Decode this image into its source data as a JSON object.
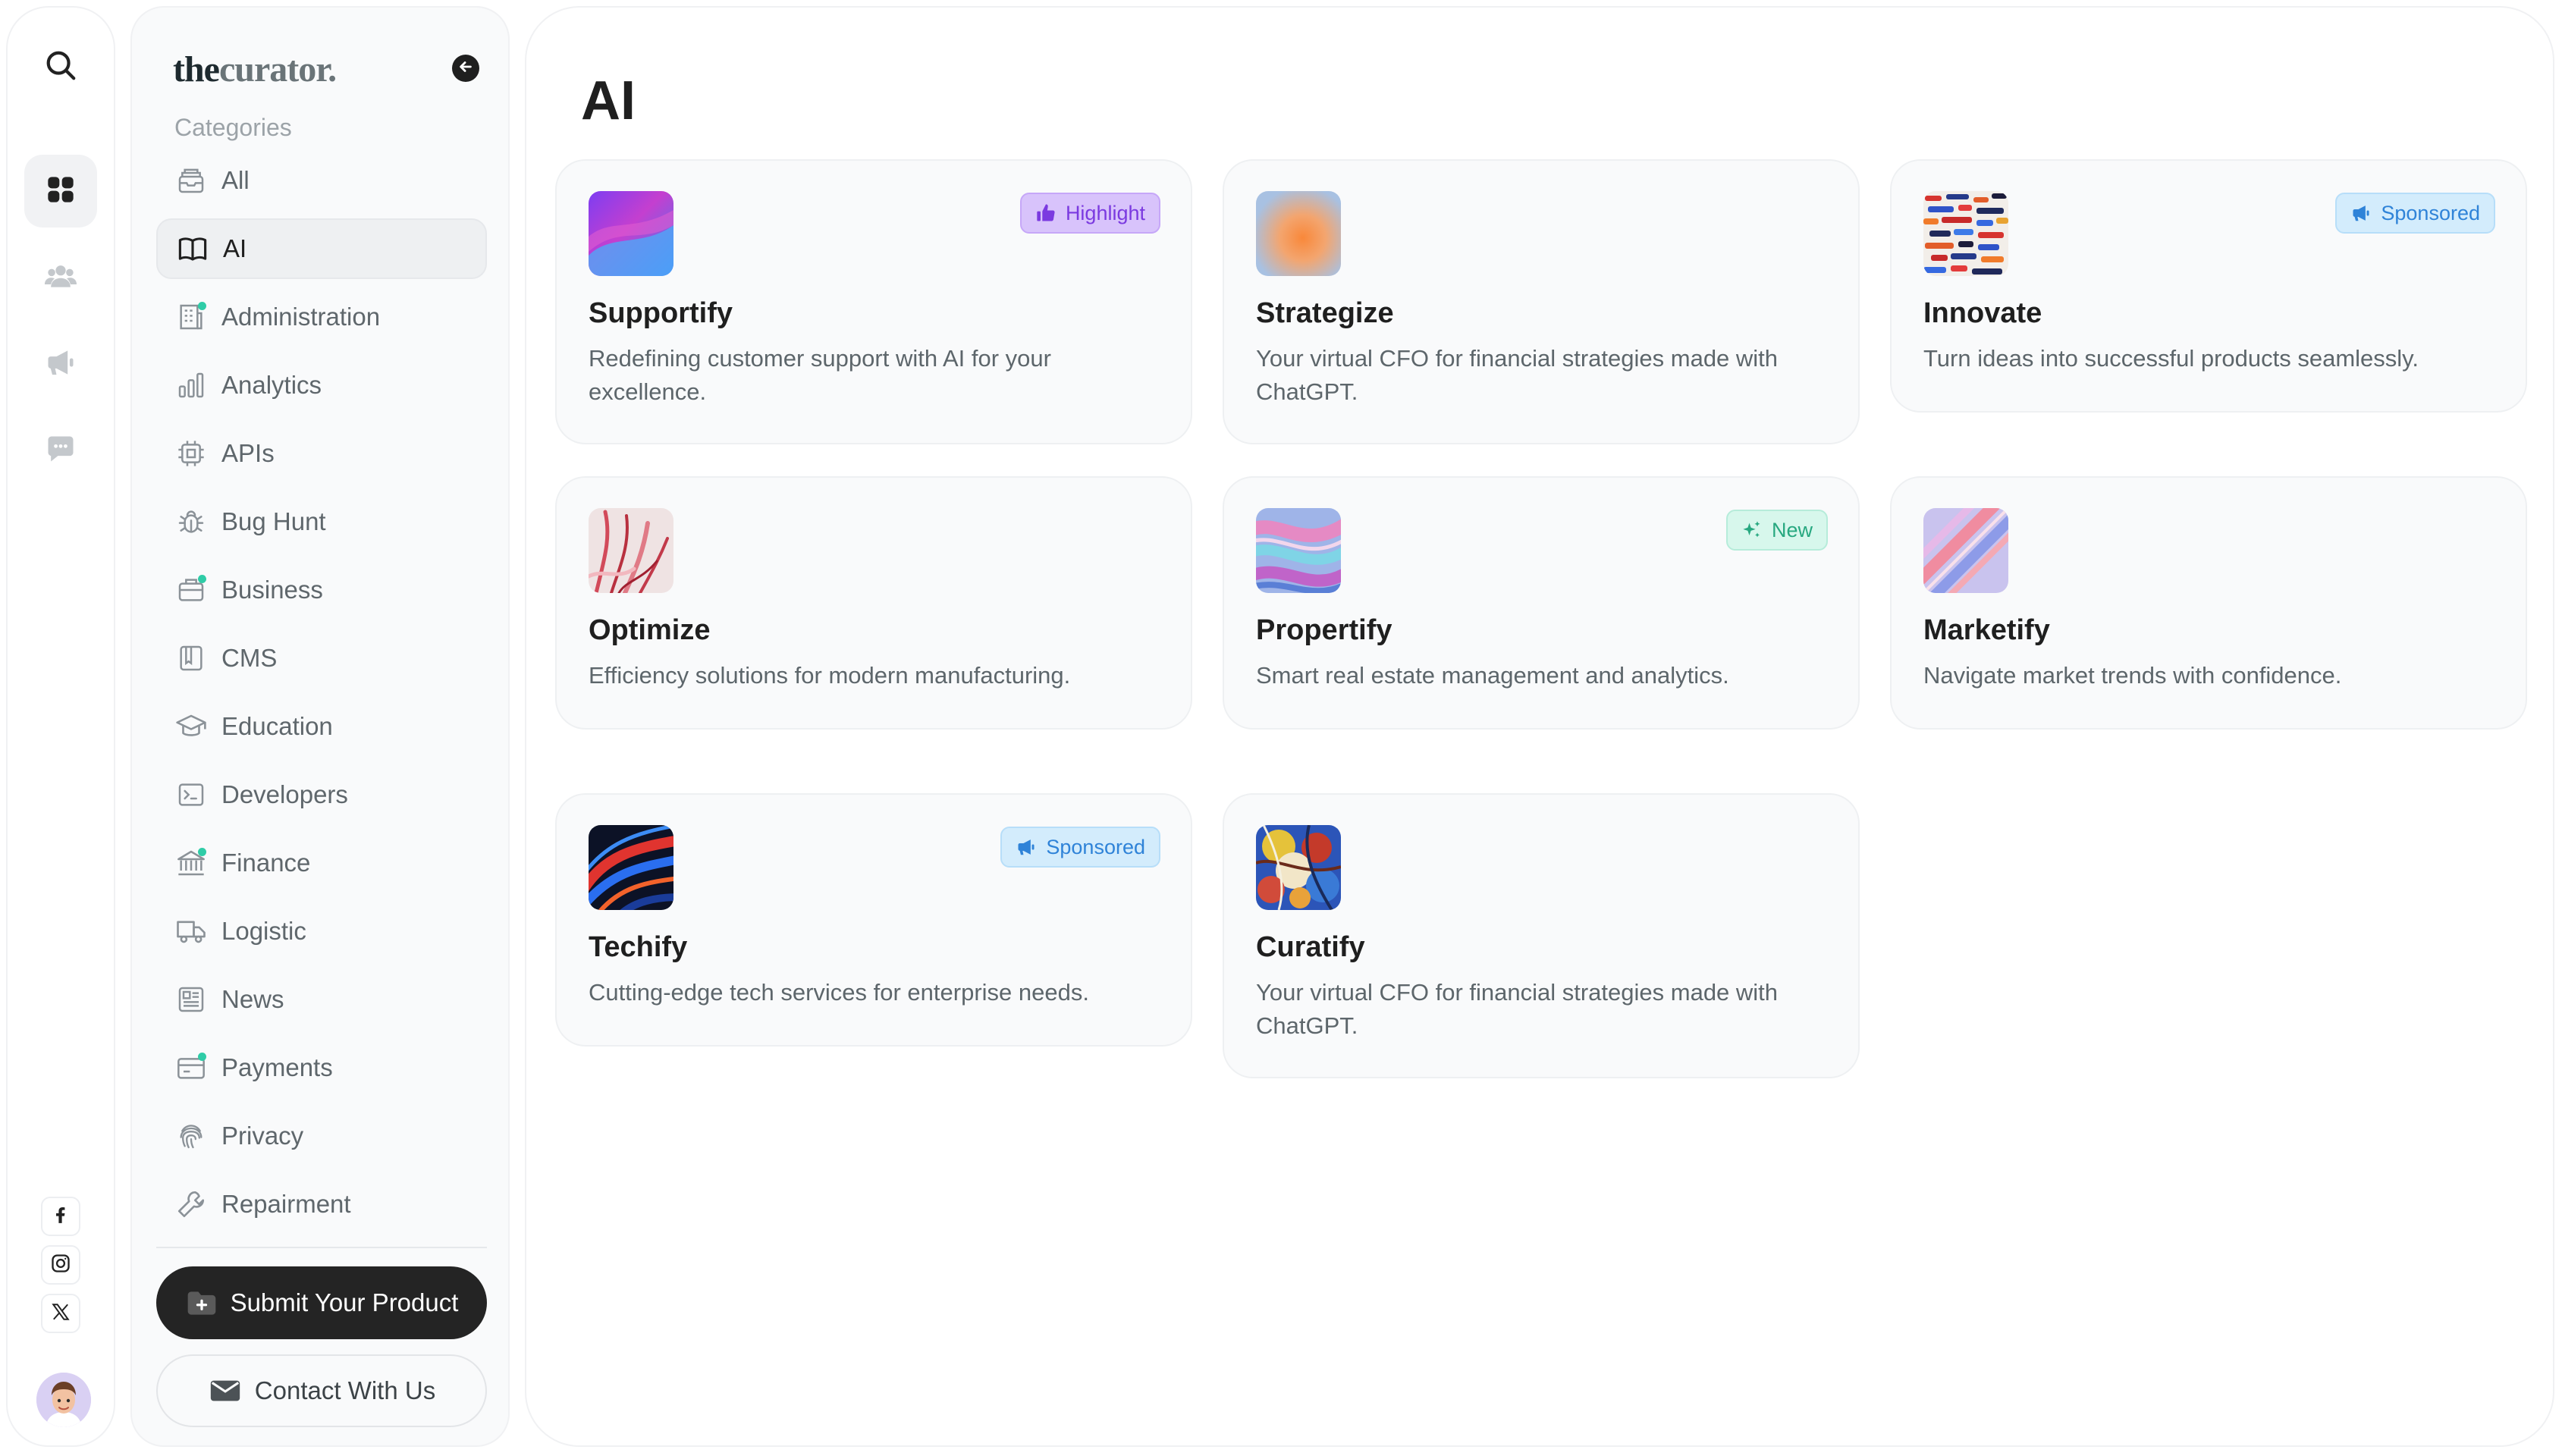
{
  "brand": {
    "logo_part1": "the",
    "logo_part2": "curator."
  },
  "sidebar": {
    "categories_heading": "Categories",
    "items": [
      {
        "label": "All",
        "icon": "tray-icon"
      },
      {
        "label": "AI",
        "icon": "book-icon"
      },
      {
        "label": "Administration",
        "icon": "building-icon"
      },
      {
        "label": "Analytics",
        "icon": "bar-chart-icon"
      },
      {
        "label": "APIs",
        "icon": "chip-icon"
      },
      {
        "label": "Bug Hunt",
        "icon": "bug-icon"
      },
      {
        "label": "Business",
        "icon": "briefcase-icon"
      },
      {
        "label": "CMS",
        "icon": "book-open-icon"
      },
      {
        "label": "Education",
        "icon": "graduation-cap-icon"
      },
      {
        "label": "Developers",
        "icon": "terminal-icon"
      },
      {
        "label": "Finance",
        "icon": "bank-icon"
      },
      {
        "label": "Logistic",
        "icon": "truck-icon"
      },
      {
        "label": "News",
        "icon": "newspaper-icon"
      },
      {
        "label": "Payments",
        "icon": "credit-card-icon"
      },
      {
        "label": "Privacy",
        "icon": "fingerprint-icon"
      },
      {
        "label": "Repairment",
        "icon": "wrench-icon"
      }
    ],
    "active_item": "AI",
    "submit_label": "Submit Your Product",
    "contact_label": "Contact With Us"
  },
  "main": {
    "title": "AI",
    "cards": [
      {
        "name": "Supportify",
        "description": "Redefining customer support with AI for your excellence.",
        "badge": "Highlight",
        "badge_type": "highlight"
      },
      {
        "name": "Strategize",
        "description": "Your virtual CFO for financial strategies made with ChatGPT.",
        "badge": "",
        "badge_type": ""
      },
      {
        "name": "Innovate",
        "description": "Turn ideas into successful products seamlessly.",
        "badge": "Sponsored",
        "badge_type": "sponsored"
      },
      {
        "name": "Optimize",
        "description": "Efficiency solutions for modern manufacturing.",
        "badge": "",
        "badge_type": ""
      },
      {
        "name": "Propertify",
        "description": "Smart real estate management and analytics.",
        "badge": "New",
        "badge_type": "new"
      },
      {
        "name": "Marketify",
        "description": "Navigate market trends with confidence.",
        "badge": "",
        "badge_type": ""
      },
      {
        "name": "Techify",
        "description": "Cutting-edge tech services for enterprise needs.",
        "badge": "Sponsored",
        "badge_type": "sponsored"
      },
      {
        "name": "Curatify",
        "description": "Your virtual CFO for financial strategies made with ChatGPT.",
        "badge": "",
        "badge_type": ""
      }
    ]
  },
  "colors": {
    "accent_dark": "#242424",
    "highlight": "#7b3ae0",
    "sponsored": "#2f83d8",
    "new": "#27a880",
    "notification_dot": "#2fcca7"
  }
}
